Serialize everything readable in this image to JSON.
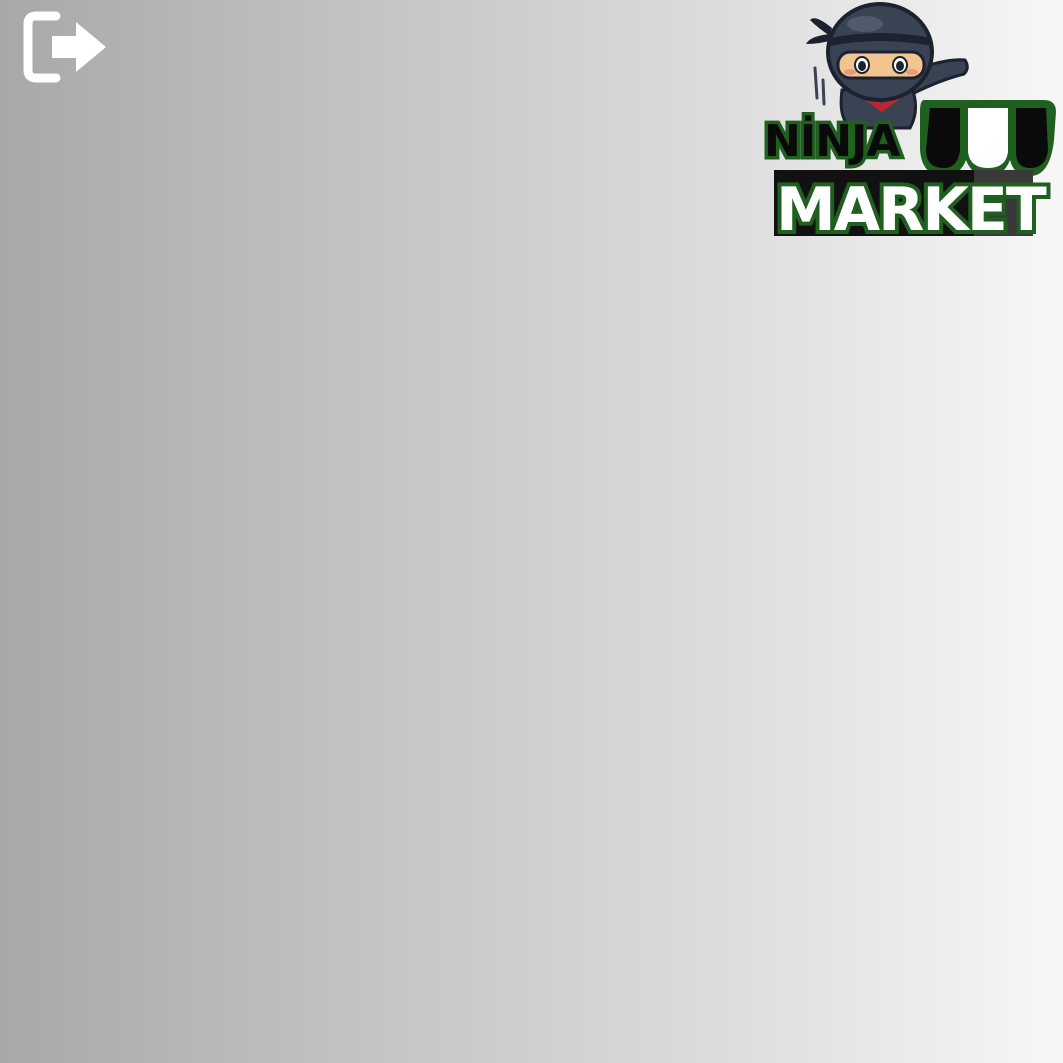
{
  "header": {
    "logout_icon": "logout-icon"
  },
  "logo": {
    "line1": "NİNJA",
    "line2": "MARKET",
    "mascot_icon": "ninja-mascot-icon",
    "awning_icon": "shop-awning-icon"
  },
  "colors": {
    "background_left": "#a8a8a8",
    "background_right": "#f7f7f7",
    "icon": "#ffffff",
    "logo_outline": "#1f5f1f",
    "logo_dark": "#0a0a0a",
    "logo_white": "#ffffff",
    "ninja_body": "#3a4354",
    "ninja_skin": "#f2c48f",
    "ninja_accent": "#c0272d"
  }
}
